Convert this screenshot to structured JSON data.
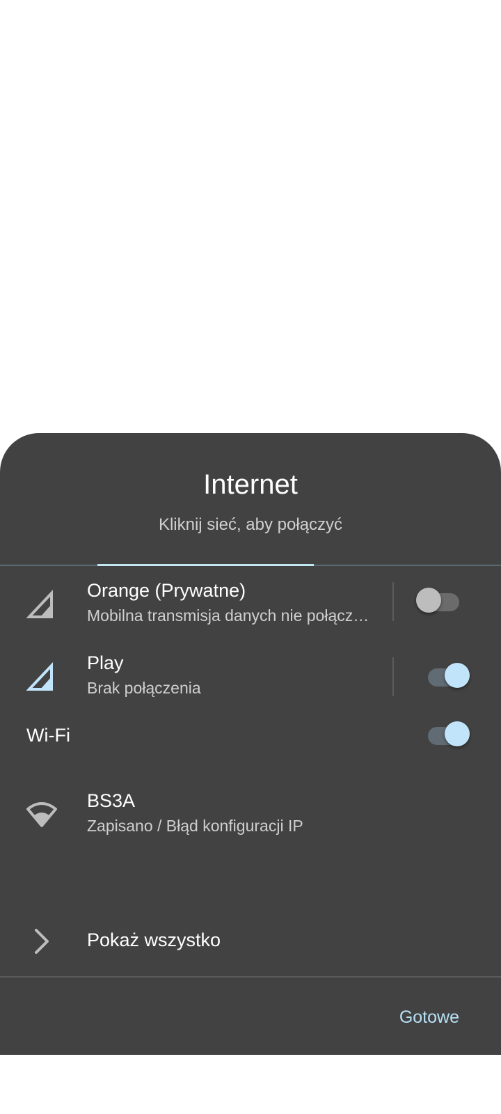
{
  "dialog": {
    "title": "Internet",
    "subtitle": "Kliknij sieć, aby połączyć"
  },
  "mobile_networks": [
    {
      "name": "Orange (Prywatne)",
      "status": "Mobilna transmisja danych nie połączona",
      "icon": "signal-icon",
      "enabled": false
    },
    {
      "name": "Play",
      "status": "Brak połączenia",
      "icon": "signal-icon",
      "enabled": true
    }
  ],
  "wifi": {
    "label": "Wi-Fi",
    "enabled": true,
    "networks": [
      {
        "name": "BS3A",
        "status": "Zapisano / Błąd konfiguracji IP",
        "icon": "wifi-icon"
      }
    ]
  },
  "show_all": {
    "label": "Pokaż wszystko",
    "icon": "chevron-right-icon"
  },
  "footer": {
    "done_label": "Gotowe"
  },
  "colors": {
    "sheet_background": "#424242",
    "accent": "#c2e4fb",
    "text_primary": "#ffffff",
    "text_secondary": "#cfcfcf"
  }
}
